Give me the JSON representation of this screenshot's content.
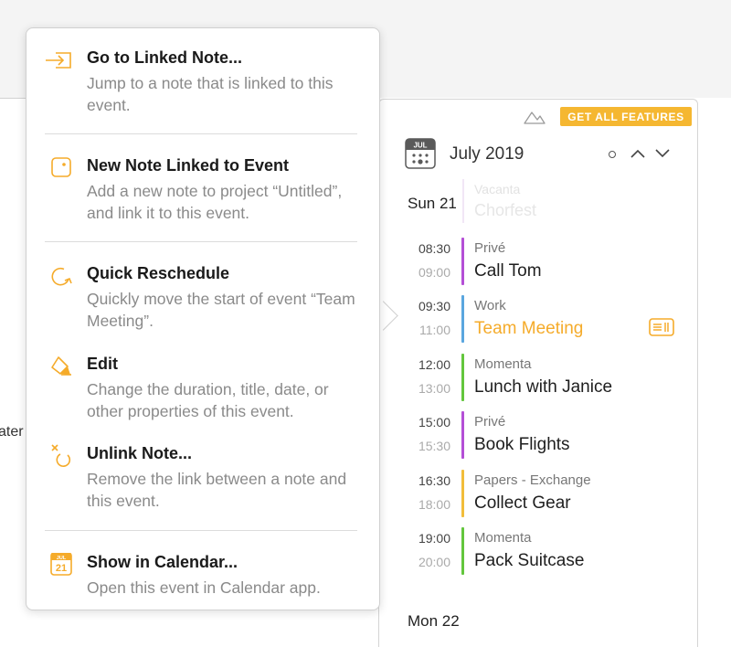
{
  "background": {
    "partial_text": "ater"
  },
  "calendar": {
    "get_features_label": "GET ALL FEATURES",
    "month_title": "July 2019",
    "icon_month": "JUL",
    "days": [
      {
        "label": "Sun 21"
      },
      {
        "label": "Mon 22"
      }
    ],
    "faded_event": {
      "category": "Vacanta",
      "title": "Chorfest"
    },
    "events": [
      {
        "start": "08:30",
        "end": "09:00",
        "category": "Privé",
        "title": "Call Tom",
        "color": "#b44fd6"
      },
      {
        "start": "09:30",
        "end": "11:00",
        "category": "Work",
        "title": "Team Meeting",
        "color": "#5aa6df",
        "highlight": true,
        "has_note": true
      },
      {
        "start": "12:00",
        "end": "13:00",
        "category": "Momenta",
        "title": "Lunch with Janice",
        "color": "#63c63d"
      },
      {
        "start": "15:00",
        "end": "15:30",
        "category": "Privé",
        "title": "Book Flights",
        "color": "#b44fd6"
      },
      {
        "start": "16:30",
        "end": "18:00",
        "category": "Papers - Exchange",
        "title": "Collect Gear",
        "color": "#f2bd3a"
      },
      {
        "start": "19:00",
        "end": "20:00",
        "category": "Momenta",
        "title": "Pack Suitcase",
        "color": "#63c63d"
      }
    ]
  },
  "menu": {
    "accent_color": "#f5ab2a",
    "items": [
      {
        "icon": "link-enter-icon",
        "title": "Go to Linked Note...",
        "description": "Jump to a note that is linked to this event."
      },
      {
        "icon": "new-note-icon",
        "title": "New Note Linked to Event",
        "description": "Add a new note to project “Untitled”, and link it to this event."
      },
      {
        "icon": "reschedule-icon",
        "title": "Quick Reschedule",
        "description": "Quickly move the start of event “Team Meeting”."
      },
      {
        "icon": "edit-pencil-icon",
        "title": "Edit",
        "description": "Change the duration, title, date, or other properties of this event."
      },
      {
        "icon": "unlink-icon",
        "title": "Unlink Note...",
        "description": "Remove the link between a note and this event."
      },
      {
        "icon": "calendar-app-icon",
        "title": "Show in Calendar...",
        "description": "Open this event in Calendar app.",
        "icon_month": "JUL",
        "icon_day": "21"
      }
    ]
  }
}
